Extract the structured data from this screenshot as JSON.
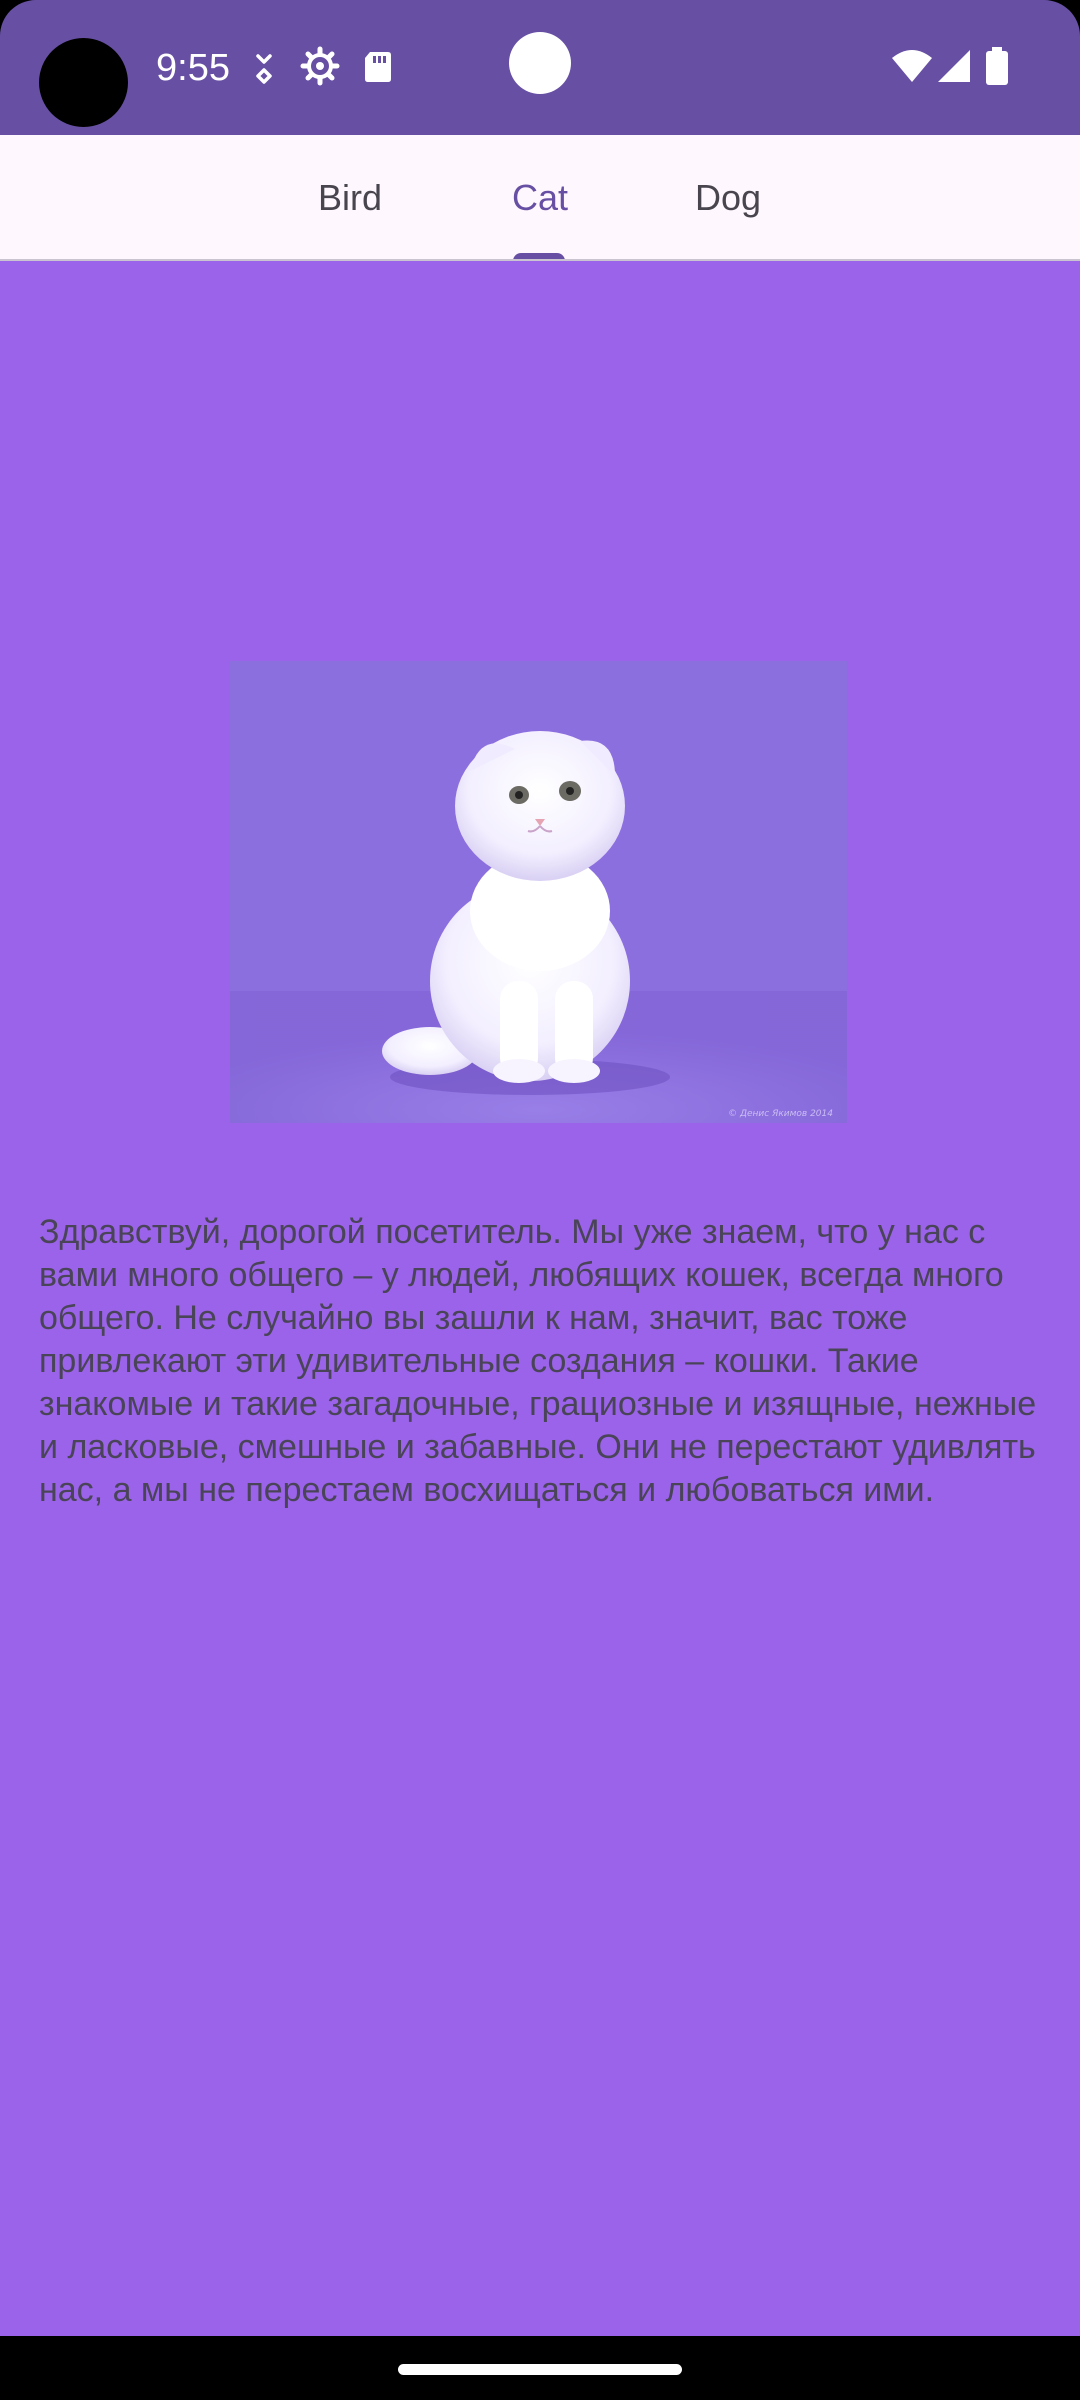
{
  "status_bar": {
    "time": "9:55",
    "icons": [
      "keyboard-arrows-icon",
      "settings-gear-icon",
      "sd-card-icon"
    ],
    "right_icons": [
      "wifi-icon",
      "cellular-signal-icon",
      "battery-icon"
    ],
    "background_color": "#6750A4"
  },
  "tabs": [
    {
      "label": "Bird"
    },
    {
      "label": "Cat"
    },
    {
      "label": "Dog"
    }
  ],
  "selected_tab": "Cat",
  "accent_color": "#6750A4",
  "content": {
    "background_color": "#9B63EA",
    "image": {
      "subject": "white-kitten-photo",
      "watermark": "© Денис Якимов 2014"
    },
    "text": "Здравствуй, дорогой посетитель. Мы уже знаем, что у нас с вами много общего – у людей, любящих кошек, всегда много общего. Не случайно вы зашли к нам, значит, вас тоже привлекают эти удивительные создания – кошки. Такие знакомые и такие загадочные, грациозные и изящные, нежные и ласковые, смешные и забавные. Они не перестают удивлять нас, а мы не перестаем восхищаться и любоваться ими."
  }
}
